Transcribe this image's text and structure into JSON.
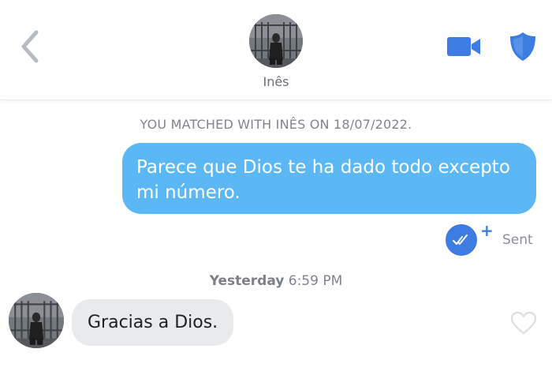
{
  "header": {
    "back_icon": "chevron-left-icon",
    "match_name": "Inês",
    "video_icon": "video-camera-icon",
    "safety_icon": "shield-icon",
    "accent_color": "#3d7ce0"
  },
  "conversation": {
    "match_notice": "YOU MATCHED WITH INÊS ON 18/07/2022.",
    "sent_message": {
      "text": "Parece que Dios te ha dado todo excepto mi número.",
      "bubble_color": "#5cb8f5",
      "receipt_icon": "double-check-icon",
      "receipt_plus": "+",
      "status": "Sent"
    },
    "timestamp": {
      "day": "Yesterday",
      "time": "6:59 PM"
    },
    "received_message": {
      "text": "Gracias a Dios.",
      "bubble_color": "#e9eaec",
      "like_icon": "heart-outline-icon"
    }
  }
}
